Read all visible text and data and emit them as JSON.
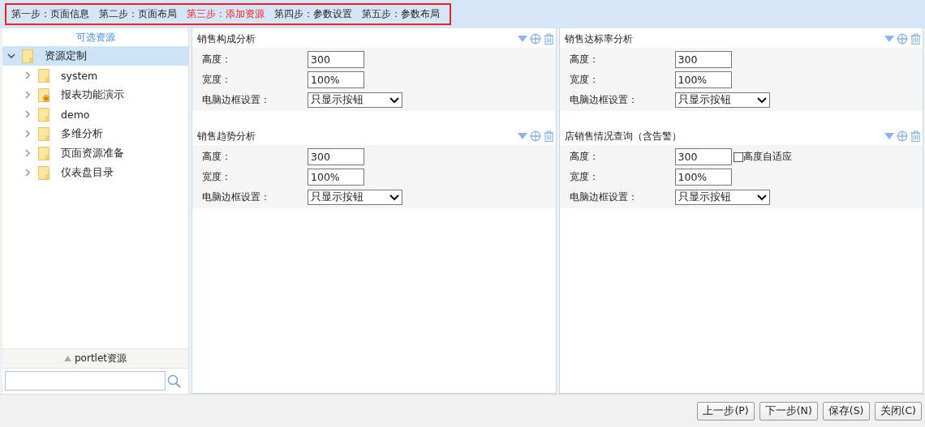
{
  "steps": [
    {
      "label": "第一步：页面信息",
      "selected": false
    },
    {
      "label": "第二步：页面布局",
      "selected": false
    },
    {
      "label": "第三步：添加资源",
      "selected": true
    },
    {
      "label": "第四步：参数设置",
      "selected": false
    },
    {
      "label": "第五步：参数布局",
      "selected": false
    }
  ],
  "sidebar": {
    "title": "可选资源",
    "tree": [
      {
        "label": "资源定制",
        "kind": "folder",
        "expanded": true,
        "selected": true,
        "children": [
          {
            "label": "system",
            "kind": "folder",
            "expanded": false,
            "selected": false
          },
          {
            "label": "报表功能演示",
            "kind": "report-folder",
            "expanded": false,
            "selected": false
          },
          {
            "label": "demo",
            "kind": "folder",
            "expanded": false,
            "selected": false
          },
          {
            "label": "多维分析",
            "kind": "folder",
            "expanded": false,
            "selected": false
          },
          {
            "label": "页面资源准备",
            "kind": "folder",
            "expanded": false,
            "selected": false
          },
          {
            "label": "仪表盘目录",
            "kind": "folder",
            "expanded": false,
            "selected": false
          }
        ]
      }
    ],
    "footer_title": "portlet资源"
  },
  "columns": [
    [
      {
        "title": "销售构成分析",
        "fields": [
          {
            "label": "高度：",
            "value": "300",
            "kind": "text"
          },
          {
            "label": "宽度：",
            "value": "100%",
            "kind": "text"
          },
          {
            "label": "电脑边框设置：",
            "value": "只显示按钮",
            "kind": "select"
          }
        ]
      },
      {
        "title": "销售趋势分析",
        "fields": [
          {
            "label": "高度：",
            "value": "300",
            "kind": "text"
          },
          {
            "label": "宽度：",
            "value": "100%",
            "kind": "text"
          },
          {
            "label": "电脑边框设置：",
            "value": "只显示按钮",
            "kind": "select"
          }
        ]
      }
    ],
    [
      {
        "title": "销售达标率分析",
        "fields": [
          {
            "label": "高度：",
            "value": "300",
            "kind": "text"
          },
          {
            "label": "宽度：",
            "value": "100%",
            "kind": "text"
          },
          {
            "label": "电脑边框设置：",
            "value": "只显示按钮",
            "kind": "select"
          }
        ]
      },
      {
        "title": "店销售情况查询（含告警）",
        "fields": [
          {
            "label": "高度：",
            "value": "300",
            "kind": "text",
            "option": {
              "label": "高度自适应",
              "checked": false
            }
          },
          {
            "label": "宽度：",
            "value": "100%",
            "kind": "text"
          },
          {
            "label": "电脑边框设置：",
            "value": "只显示按钮",
            "kind": "select"
          }
        ]
      }
    ]
  ],
  "buttons": [
    "上一步(P)",
    "下一步(N)",
    "保存(S)",
    "关闭(C)"
  ]
}
